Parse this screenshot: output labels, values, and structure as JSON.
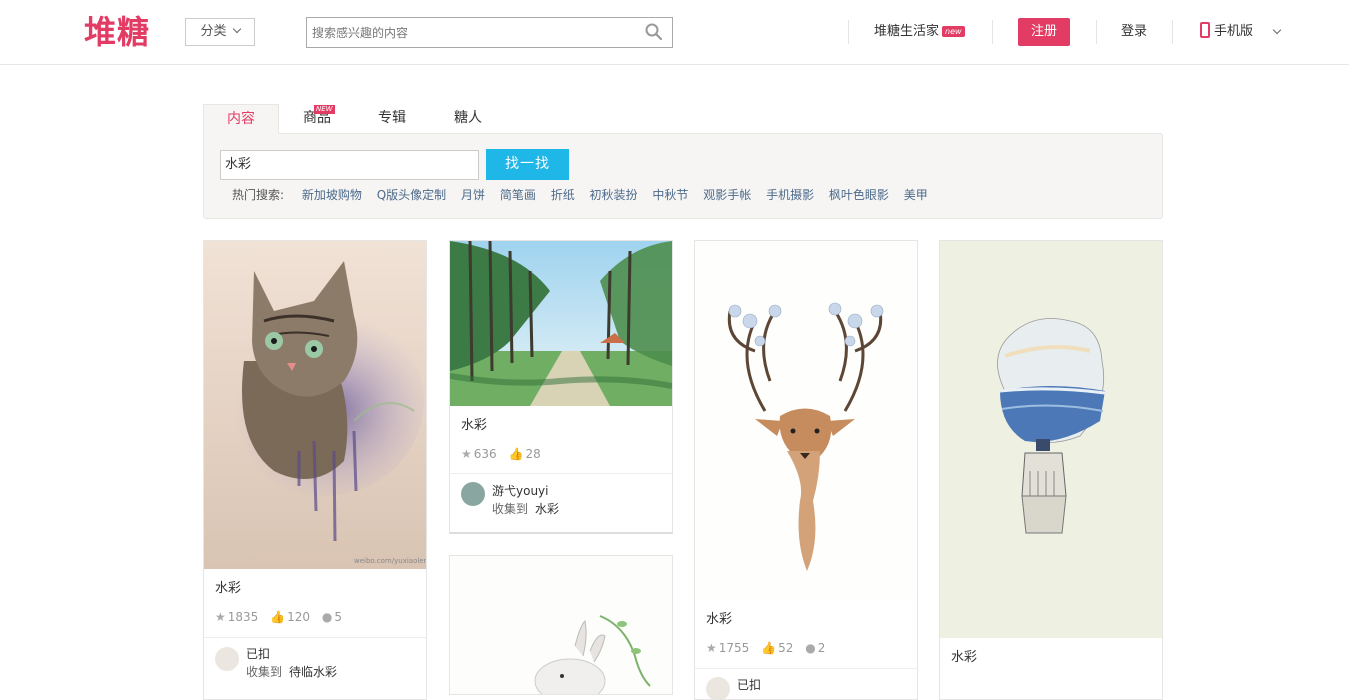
{
  "header": {
    "logo": "堆糖",
    "category_label": "分类",
    "search_placeholder": "搜索感兴趣的内容",
    "life_label": "堆糖生活家",
    "life_badge": "new",
    "register_label": "注册",
    "login_label": "登录",
    "mobile_label": "手机版"
  },
  "tabs": [
    {
      "label": "内容",
      "active": true
    },
    {
      "label": "商品",
      "badge": "NEW"
    },
    {
      "label": "专辑"
    },
    {
      "label": "糖人"
    }
  ],
  "search_panel": {
    "keyword": "水彩",
    "button_label": "找一找",
    "hot_label": "热门搜索:",
    "hot_terms": [
      "新加坡购物",
      "Q版头像定制",
      "月饼",
      "简笔画",
      "折纸",
      "初秋装扮",
      "中秋节",
      "观影手帐",
      "手机摄影",
      "枫叶色眼影",
      "美甲"
    ]
  },
  "cards": [
    {
      "title": "水彩",
      "stars": "1835",
      "likes": "120",
      "comments": "5",
      "user": "已扣",
      "collect_label": "收集到",
      "album": "待临水彩",
      "watermark": "weibo.com/yuxiaoleng"
    },
    {
      "title": "水彩",
      "stars": "636",
      "likes": "28",
      "user": "游弋youyi",
      "collect_label": "收集到",
      "album": "水彩"
    },
    {
      "title": "水彩",
      "stars": "1755",
      "likes": "52",
      "comments": "2",
      "user": "已扣"
    },
    {
      "title": "水彩"
    }
  ],
  "colors": {
    "brand": "#e33c64",
    "find_button": "#1fb6e8",
    "hot_link": "#4c6a8a"
  }
}
